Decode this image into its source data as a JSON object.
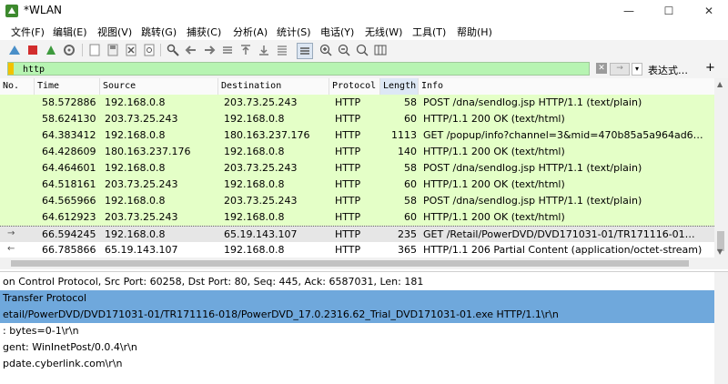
{
  "window": {
    "title": "*WLAN",
    "min": "—",
    "max": "☐",
    "close": "✕"
  },
  "menu": [
    "文件(F)",
    "编辑(E)",
    "视图(V)",
    "跳转(G)",
    "捕获(C)",
    "分析(A)",
    "统计(S)",
    "电话(Y)",
    "无线(W)",
    "工具(T)",
    "帮助(H)"
  ],
  "toolbar_icons": [
    "shark-fin-start-icon",
    "stop-capture-icon",
    "restart-capture-icon",
    "capture-options-icon",
    "open-file-icon",
    "save-file-icon",
    "close-file-icon",
    "reload-file-icon",
    "find-packet-icon",
    "go-back-icon",
    "go-forward-icon",
    "go-to-packet-icon",
    "first-packet-icon",
    "last-packet-icon",
    "auto-scroll-icon",
    "colorize-icon",
    "zoom-in-icon",
    "zoom-out-icon",
    "zoom-reset-icon",
    "resize-columns-icon"
  ],
  "filter": {
    "value": "http",
    "expression_label": "表达式…",
    "add_label": "+"
  },
  "columns": [
    "No.",
    "Time",
    "Source",
    "Destination",
    "Protocol",
    "Length",
    "Info"
  ],
  "packets": [
    {
      "time": "58.572886",
      "source": "192.168.0.8",
      "destination": "203.73.25.243",
      "protocol": "HTTP",
      "length": "58",
      "info": "POST /dna/sendlog.jsp HTTP/1.1  (text/plain)"
    },
    {
      "time": "58.624130",
      "source": "203.73.25.243",
      "destination": "192.168.0.8",
      "protocol": "HTTP",
      "length": "60",
      "info": "HTTP/1.1 200 OK  (text/html)"
    },
    {
      "time": "64.383412",
      "source": "192.168.0.8",
      "destination": "180.163.237.176",
      "protocol": "HTTP",
      "length": "1113",
      "info": "GET /popup/info?channel=3&mid=470b85a5a964ad6…"
    },
    {
      "time": "64.428609",
      "source": "180.163.237.176",
      "destination": "192.168.0.8",
      "protocol": "HTTP",
      "length": "140",
      "info": "HTTP/1.1 200 OK  (text/html)"
    },
    {
      "time": "64.464601",
      "source": "192.168.0.8",
      "destination": "203.73.25.243",
      "protocol": "HTTP",
      "length": "58",
      "info": "POST /dna/sendlog.jsp HTTP/1.1  (text/plain)"
    },
    {
      "time": "64.518161",
      "source": "203.73.25.243",
      "destination": "192.168.0.8",
      "protocol": "HTTP",
      "length": "60",
      "info": "HTTP/1.1 200 OK  (text/html)"
    },
    {
      "time": "64.565966",
      "source": "192.168.0.8",
      "destination": "203.73.25.243",
      "protocol": "HTTP",
      "length": "58",
      "info": "POST /dna/sendlog.jsp HTTP/1.1  (text/plain)"
    },
    {
      "time": "64.612923",
      "source": "203.73.25.243",
      "destination": "192.168.0.8",
      "protocol": "HTTP",
      "length": "60",
      "info": "HTTP/1.1 200 OK  (text/html)"
    },
    {
      "time": "66.594245",
      "source": "192.168.0.8",
      "destination": "65.19.143.107",
      "protocol": "HTTP",
      "length": "235",
      "info": "GET /Retail/PowerDVD/DVD171031-01/TR171116-01…",
      "selected": true
    },
    {
      "time": "66.785866",
      "source": "65.19.143.107",
      "destination": "192.168.0.8",
      "protocol": "HTTP",
      "length": "365",
      "info": "HTTP/1.1 206 Partial Content  (application/octet-stream)",
      "white": true
    }
  ],
  "details": [
    {
      "text": "on Control Protocol, Src Port: 60258, Dst Port: 80, Seq: 445, Ack: 6587031, Len: 181",
      "selected": false
    },
    {
      "text": " Transfer Protocol",
      "selected": true
    },
    {
      "text": "etail/PowerDVD/DVD171031-01/TR171116-018/PowerDVD_17.0.2316.62_Trial_DVD171031-01.exe HTTP/1.1\\r\\n",
      "selected": true
    },
    {
      "text": ": bytes=0-1\\r\\n",
      "selected": false
    },
    {
      "text": "gent: WinInetPost/0.0.4\\r\\n",
      "selected": false
    },
    {
      "text": "pdate.cyberlink.com\\r\\n",
      "selected": false
    }
  ]
}
